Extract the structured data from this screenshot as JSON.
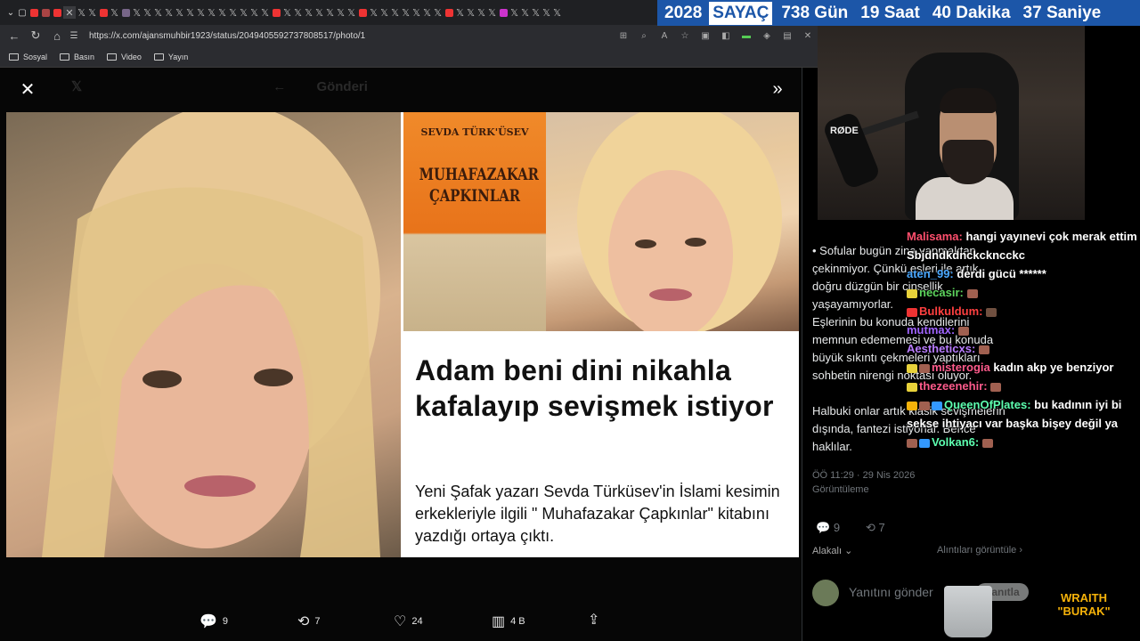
{
  "browser": {
    "url": "https://x.com/ajansmuhbir1923/status/2049405592737808517/photo/1",
    "bookmarks": [
      "Sosyal",
      "Basın",
      "Video",
      "Yayın"
    ]
  },
  "counter": {
    "year": "2028",
    "label": "SAYAÇ",
    "days": "738 Gün",
    "hours": "19 Saat",
    "minutes": "40 Dakika",
    "seconds": "37 Saniye"
  },
  "modal": {
    "header_ghost": "Gönderi",
    "book_author": "SEVDA TÜRK'ÜSEV",
    "book_title": "MUHAFAZAKAR ÇAPKINLAR",
    "headline": "Adam beni dini nikahla kafalayıp sevişmek istiyor",
    "subline": "Yeni Şafak yazarı Sevda Türküsev'in İslami kesimin erkekleriyle ilgili \" Muhafazakar Çapkınlar\" kitabını yazdığı ortaya çıktı.",
    "actions": {
      "replies": "9",
      "reposts": "7",
      "likes": "24",
      "views": "4 B"
    }
  },
  "tweet_panel": {
    "p1": "• Sofular bugün zina yapmaktan çekinmiyor. Çünkü eşleri ile artık doğru düzgün bir cinsellik yaşayamıyorlar.",
    "p2": "Eşlerinin bu konuda kendilerini memnun edememesi ve bu konuda büyük sıkıntı çekmeleri yaptıkları sohbetin nirengi noktası oluyor.",
    "p3": "Halbuki onlar artık klasik sevişmelerin dışında, fantezi istiyorlar. Bence haklılar.",
    "time": "ÖÖ 11:29 · 29 Nis 2026",
    "views_label": "Görüntüleme",
    "replies": "9",
    "reposts": "7",
    "related": "Alakalı",
    "quotes_label": "Alıntıları görüntüle",
    "reply_placeholder": "Yanıtını gönder",
    "reply_button": "Yanıtla"
  },
  "webcam": {
    "mic_brand": "RØDE"
  },
  "chat": [
    {
      "user": "Malisama:",
      "color": "#ff4f6d",
      "msg": "hangi yayınevi çok merak ettim"
    },
    {
      "user": "",
      "color": "#ffffff",
      "msg": "Sbjdndkdnckckncckc"
    },
    {
      "user": "aten_99:",
      "color": "#4aa8ff",
      "msg": "derdi gücü ******"
    },
    {
      "user": "necasir:",
      "color": "#5dd45d",
      "msg": ""
    },
    {
      "user": "Bulkuldum:",
      "color": "#ff4040",
      "msg": ""
    },
    {
      "user": "mutmax:",
      "color": "#a064ff",
      "msg": ""
    },
    {
      "user": "Aestheticxs:",
      "color": "#b97cff",
      "msg": ""
    },
    {
      "user": "misterogia",
      "color": "#ff5b8c",
      "msg": "kadın akp ye benziyor"
    },
    {
      "user": "thezeenehir:",
      "color": "#ff5b8c",
      "msg": ""
    },
    {
      "user": "QueenOfPlates:",
      "color": "#5dffb0",
      "msg": "bu kadının iyi bi sekse ihtiyacı var başka bişey değil ya"
    },
    {
      "user": "Volkan6:",
      "color": "#5dffb0",
      "msg": ""
    }
  ],
  "logo": {
    "line1": "WRAITH",
    "line2": "\"BURAK\""
  }
}
